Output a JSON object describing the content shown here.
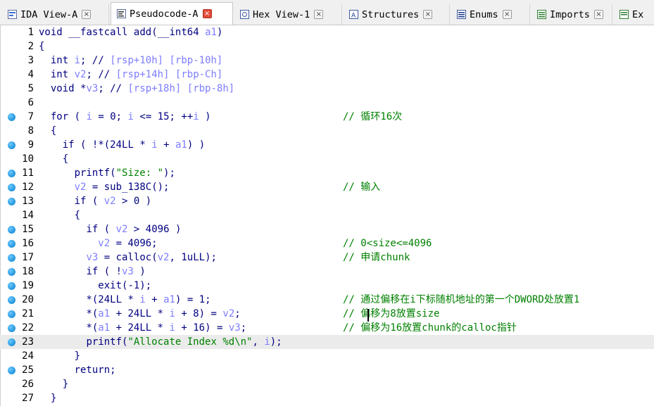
{
  "tabs": [
    {
      "label": "IDA View-A",
      "icon": "ida-view-icon",
      "active": false
    },
    {
      "label": "Pseudocode-A",
      "icon": "pseudocode-icon",
      "active": true
    },
    {
      "label": "Hex View-1",
      "icon": "hex-view-icon",
      "active": false
    },
    {
      "label": "Structures",
      "icon": "structures-icon",
      "active": false
    },
    {
      "label": "Enums",
      "icon": "enums-icon",
      "active": false
    },
    {
      "label": "Imports",
      "icon": "imports-icon",
      "active": false
    },
    {
      "label": "Ex",
      "icon": "exports-icon",
      "active": false
    }
  ],
  "close_glyph": "×",
  "colors": {
    "keyword": "#000080",
    "variable": "#7d7dff",
    "string": "#008000",
    "comment": "#008000",
    "breakpoint_dot": "#2a9be0",
    "active_close": "#e04a3a"
  },
  "lines": [
    {
      "num": "1",
      "dot": false,
      "code": "void __fastcall add(__int64 a1)",
      "comment": ""
    },
    {
      "num": "2",
      "dot": false,
      "code": "{",
      "comment": ""
    },
    {
      "num": "3",
      "dot": false,
      "code": "  int i; // [rsp+10h] [rbp-10h]",
      "comment": ""
    },
    {
      "num": "4",
      "dot": false,
      "code": "  int v2; // [rsp+14h] [rbp-Ch]",
      "comment": ""
    },
    {
      "num": "5",
      "dot": false,
      "code": "  void *v3; // [rsp+18h] [rbp-8h]",
      "comment": ""
    },
    {
      "num": "6",
      "dot": false,
      "code": "",
      "comment": ""
    },
    {
      "num": "7",
      "dot": true,
      "code": "  for ( i = 0; i <= 15; ++i )",
      "comment": "// 循环16次"
    },
    {
      "num": "8",
      "dot": false,
      "code": "  {",
      "comment": ""
    },
    {
      "num": "9",
      "dot": true,
      "code": "    if ( !*(24LL * i + a1) )",
      "comment": ""
    },
    {
      "num": "10",
      "dot": false,
      "code": "    {",
      "comment": ""
    },
    {
      "num": "11",
      "dot": true,
      "code": "      printf(\"Size: \");",
      "comment": ""
    },
    {
      "num": "12",
      "dot": true,
      "code": "      v2 = sub_138C();",
      "comment": "// 输入"
    },
    {
      "num": "13",
      "dot": true,
      "code": "      if ( v2 > 0 )",
      "comment": ""
    },
    {
      "num": "14",
      "dot": false,
      "code": "      {",
      "comment": ""
    },
    {
      "num": "15",
      "dot": true,
      "code": "        if ( v2 > 4096 )",
      "comment": ""
    },
    {
      "num": "16",
      "dot": true,
      "code": "          v2 = 4096;",
      "comment": "// 0<size<=4096"
    },
    {
      "num": "17",
      "dot": true,
      "code": "        v3 = calloc(v2, 1uLL);",
      "comment": "// 申请chunk"
    },
    {
      "num": "18",
      "dot": true,
      "code": "        if ( !v3 )",
      "comment": ""
    },
    {
      "num": "19",
      "dot": true,
      "code": "          exit(-1);",
      "comment": ""
    },
    {
      "num": "20",
      "dot": true,
      "code": "        *(24LL * i + a1) = 1;",
      "comment": "// 通过偏移在i下标随机地址的第一个DWORD处放置1"
    },
    {
      "num": "21",
      "dot": true,
      "code": "        *(a1 + 24LL * i + 8) = v2;",
      "comment": "// 偏移为8放置size"
    },
    {
      "num": "22",
      "dot": true,
      "code": "        *(a1 + 24LL * i + 16) = v3;",
      "comment": "// 偏移为16放置chunk的calloc指针"
    },
    {
      "num": "23",
      "dot": true,
      "code": "        printf(\"Allocate Index %d\\n\", i);",
      "comment": "",
      "current": true
    },
    {
      "num": "24",
      "dot": false,
      "code": "      }",
      "comment": ""
    },
    {
      "num": "25",
      "dot": true,
      "code": "      return;",
      "comment": ""
    },
    {
      "num": "26",
      "dot": false,
      "code": "    }",
      "comment": ""
    },
    {
      "num": "27",
      "dot": false,
      "code": "  }",
      "comment": ""
    }
  ]
}
